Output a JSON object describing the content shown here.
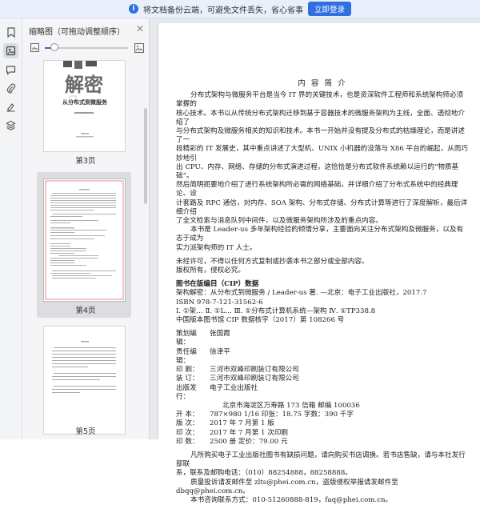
{
  "topbar": {
    "message": "将文档备份云端，可避免文件丢失，省心省事",
    "login_button": "立即登录"
  },
  "sidebar_tools": [
    "bookmark-icon",
    "thumbnail-icon",
    "comment-icon",
    "attachment-icon",
    "signature-icon",
    "layers-icon"
  ],
  "thumb_panel": {
    "title": "缩略图（可拖动调整顺序）",
    "zoom_level": 0.12,
    "pages": [
      {
        "label": "第3页",
        "cover_text": "从分布式到微服务"
      },
      {
        "label": "第4页"
      },
      {
        "label": "第5页"
      }
    ]
  },
  "document": {
    "heading": "内 容 简 介",
    "intro_lines": [
      "分布式架构与微服务平台是当今 IT 界的关键技术，也是资深软件工程师和系统架构师必须掌握的",
      "核心技术。本书以从传统分布式架构迁移到基于容器技术的微服务架构为主线，全面、透彻地介绍了",
      "与分布式架构及微服务相关的知识和技术。本书一开始并没有提及分布式的枯燥理论，而是讲述了一",
      "段精彩的 IT 发展史，其中重点讲述了大型机、UNIX 小机器的没落与 X86 平台的崛起，从而巧妙地引",
      "出 CPU、内存、网络、存储的分布式演进过程，这恰恰是分布式软件系统赖以运行的“物质基础”。",
      "然后简明扼要地介绍了进行系统架构所必需的网络基础，并详细介绍了分布式系统中的经典理论、设",
      "计套路及 RPC 通信，对内存、SOA 架构、分布式存储、分布式计算等进行了深度解析，最后详细介绍",
      "了全文检索与消息队列中间件，以及微服务架构所涉及的重点内容。"
    ],
    "audience_lines": [
      "本书是 Leader-us 多年架构经验的倾情分享，主要面向关注分布式架构及微服务，以及有志于成为",
      "实力派架构师的 IT 人士。"
    ],
    "copyright_lines": [
      "未经许可，不得以任何方式复制或抄袭本书之部分或全部内容。",
      "版权所有，侵权必究。"
    ],
    "cip_heading": "图书在版编目（CIP）数据",
    "cip_lines": [
      "架构解密：从分布式到微服务 / Leader-us 著. —北京：电子工业出版社，2017.7",
      "ISBN 978-7-121-31562-6",
      "Ⅰ. ①架…  Ⅱ. ①L…  Ⅲ. ①分布式计算机系统—架构  Ⅳ. ①TP338.8",
      "中国版本图书馆 CIP 数据核字（2017）第 108266 号"
    ],
    "pub_rows": [
      {
        "k": "策划编辑：",
        "v": "张国霞"
      },
      {
        "k": "责任编辑：",
        "v": "徐津平"
      },
      {
        "k": "印    刷：",
        "v": "三河市双峰印刷装订有限公司"
      },
      {
        "k": "装    订：",
        "v": "三河市双峰印刷装订有限公司"
      },
      {
        "k": "出版发行：",
        "v": "电子工业出版社"
      },
      {
        "k": "",
        "v": "北京市海淀区万寿路 173 信箱    邮编   100036"
      },
      {
        "k": "开    本：",
        "v": "787×980    1/16    印张：18.75    字数：390 千字"
      },
      {
        "k": "版    次：",
        "v": "2017 年 7 月第 1 版"
      },
      {
        "k": "印    次：",
        "v": "2017 年 7 月第 1 次印刷"
      },
      {
        "k": "印    数：",
        "v": "2500 册            定价：79.00 元"
      }
    ],
    "notice_lines": [
      "凡所购买电子工业出版社图书有缺损问题，请向购买书店调换。若书店售缺，请与本社发行部联",
      "系，联系及邮购电话：（010）88254888，88258888。",
      "质量投诉请发邮件至 zlts@phei.com.cn，盗版侵权举报请发邮件至 dbqq@phei.com.cn。",
      "本书咨询联系方式：010-51260888-819，faq@phei.com.cn。"
    ]
  }
}
